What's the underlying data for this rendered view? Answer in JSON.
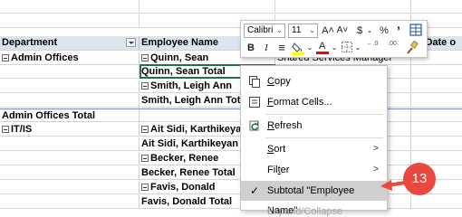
{
  "sheet": {
    "header": {
      "department": "Department",
      "employee_name": "Employee Name",
      "col4_fragment": "of Date o"
    },
    "rows": [
      {
        "c1": "",
        "c2": "",
        "c3": "",
        "c4": ""
      },
      {
        "c1": "",
        "c2": "",
        "c3": "",
        "c4": ""
      },
      {
        "c1": "Admin Offices",
        "c1_minus": true,
        "c1_bold": true,
        "c2": "Quinn, Sean",
        "c2_minus": true,
        "c2_bold": true,
        "c3": "Shared Services Manager",
        "c4": ""
      },
      {
        "c1": "",
        "c2": "Quinn, Sean Total",
        "c2_bold": true,
        "c3": "",
        "c4": ""
      },
      {
        "c1": "",
        "c2": "Smith, Leigh Ann",
        "c2_minus": true,
        "c2_bold": true,
        "c3": "",
        "c4": ""
      },
      {
        "c1": "",
        "c2": "Smith, Leigh Ann Total",
        "c2_bold": true,
        "c3": "",
        "c4": ""
      },
      {
        "c1": "Admin Offices Total",
        "c1_bold": true,
        "c2": "",
        "c3": "",
        "c4": ""
      },
      {
        "c1": "IT/IS",
        "c1_minus": true,
        "c1_bold": true,
        "c2": "Ait Sidi, Karthikeyan",
        "c2_minus": true,
        "c2_bold": true,
        "c3": "",
        "c4": ""
      },
      {
        "c1": "",
        "c2": "Ait Sidi, Karthikeyan",
        "c2_bold": true,
        "c3": "",
        "c4": ""
      },
      {
        "c1": "",
        "c2": "Becker, Renee",
        "c2_minus": true,
        "c2_bold": true,
        "c3": "",
        "c4": ""
      },
      {
        "c1": "",
        "c2": "Becker, Renee Total",
        "c2_bold": true,
        "c3": "",
        "c4": ""
      },
      {
        "c1": "",
        "c2": "Favis, Donald",
        "c2_minus": true,
        "c2_bold": true,
        "c3": "",
        "c4": ""
      },
      {
        "c1": "",
        "c2": "Favis, Donald  Total",
        "c2_bold": true,
        "c3": "",
        "c4": ""
      },
      {
        "c1": "",
        "c2": "",
        "c3": "",
        "c4": ""
      }
    ]
  },
  "mini_toolbar": {
    "font_name": "Calibri",
    "font_size": "11",
    "grow_font": "A˄",
    "shrink_font": "A˅",
    "currency": "$",
    "percent": "%",
    "comma": "’",
    "bold": "B",
    "italic": "I",
    "align": "≡",
    "fill_color": "#ffff00",
    "font_color": "#ff0000",
    "font_color_glyph": "A",
    "increase_decimal": "←.0",
    "decrease_decimal": ".00",
    "colors": {
      "border": "#c6c6c6"
    }
  },
  "context_menu": {
    "items": [
      {
        "label": "Copy",
        "underline": "C",
        "icon": "copy-icon"
      },
      {
        "label": "Format Cells...",
        "underline": "F",
        "icon": "format-cells-icon"
      },
      {
        "label": "Refresh",
        "underline": "R",
        "icon": "refresh-icon"
      },
      {
        "label": "Sort",
        "underline": "S",
        "submenu": true
      },
      {
        "label": "Filter",
        "underline": "t",
        "submenu": true
      },
      {
        "label": "Subtotal \"Employee Name\"",
        "checked": true,
        "highlighted": true
      },
      {
        "label": "Expand/Collapse",
        "disabled": true,
        "submenu": true
      }
    ],
    "submenu_arrow": ">",
    "check_mark": "✓"
  },
  "callout": {
    "number": "13",
    "color": "#e8483e"
  },
  "colors": {
    "header_bg": "#dde4f0",
    "selection_border": "#217346",
    "menu_highlight": "#cfcfcf"
  }
}
